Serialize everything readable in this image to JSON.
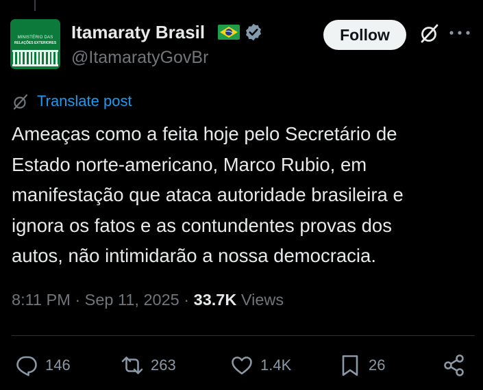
{
  "author": {
    "name": "Itamaraty Brasil",
    "handle": "@ItamaratyGovBr",
    "avatar_text": [
      "MINISTÉRIO DAS",
      "RELAÇÕES EXTERIORES"
    ],
    "avatar_color": "#0b7a3b",
    "flag_icon": "brazil-flag-icon",
    "verified_icon": "verified-badge-icon"
  },
  "header": {
    "follow_label": "Follow",
    "grok_icon": "grok-icon",
    "more_icon": "more-options-icon"
  },
  "translate": {
    "label": "Translate post",
    "icon": "grok-translate-icon"
  },
  "post": {
    "lines": [
      "Ameaças como a feita hoje pelo Secretário de",
      "Estado norte-americano, Marco Rubio, em",
      "manifestação que ataca autoridade brasileira e",
      "ignora os fatos e as contundentes provas dos",
      "autos, não intimidarão a nossa democracia."
    ]
  },
  "meta": {
    "time": "8:11 PM",
    "separator": "·",
    "date": "Sep 11, 2025",
    "views_count": "33.7K",
    "views_label": "Views"
  },
  "actions": {
    "replies": "146",
    "reposts": "263",
    "likes": "1.4K",
    "bookmarks": "26"
  },
  "colors": {
    "background": "#000000",
    "text": "#e7e9ea",
    "secondary": "#71767b",
    "link": "#1d9bf0",
    "divider": "#2f3336"
  }
}
